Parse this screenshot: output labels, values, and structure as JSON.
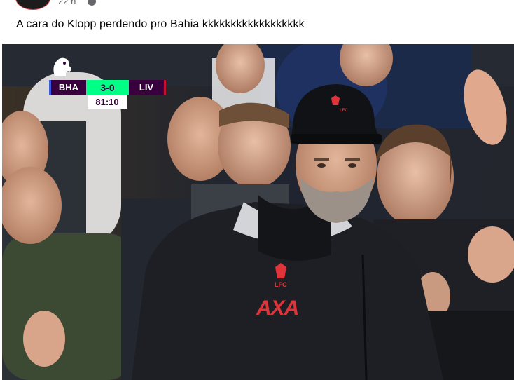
{
  "post": {
    "time": "22 h",
    "privacy_icon": "globe-icon",
    "text": "A cara do Klopp perdendo pro Bahia kkkkkkkkkkkkkkkkkk"
  },
  "scoreboard": {
    "home_team": "BHA",
    "score": "3-0",
    "away_team": "LIV",
    "clock": "81:10",
    "colors": {
      "team_bg": "#38003c",
      "score_bg": "#00ff85",
      "home_accent": "#3b5bdb",
      "away_accent": "#c8102e"
    }
  },
  "jacket": {
    "club_text": "LFC",
    "sponsor_text": "AXA",
    "accent_color": "#e0343a"
  },
  "cap": {
    "club_text": "LFC"
  }
}
